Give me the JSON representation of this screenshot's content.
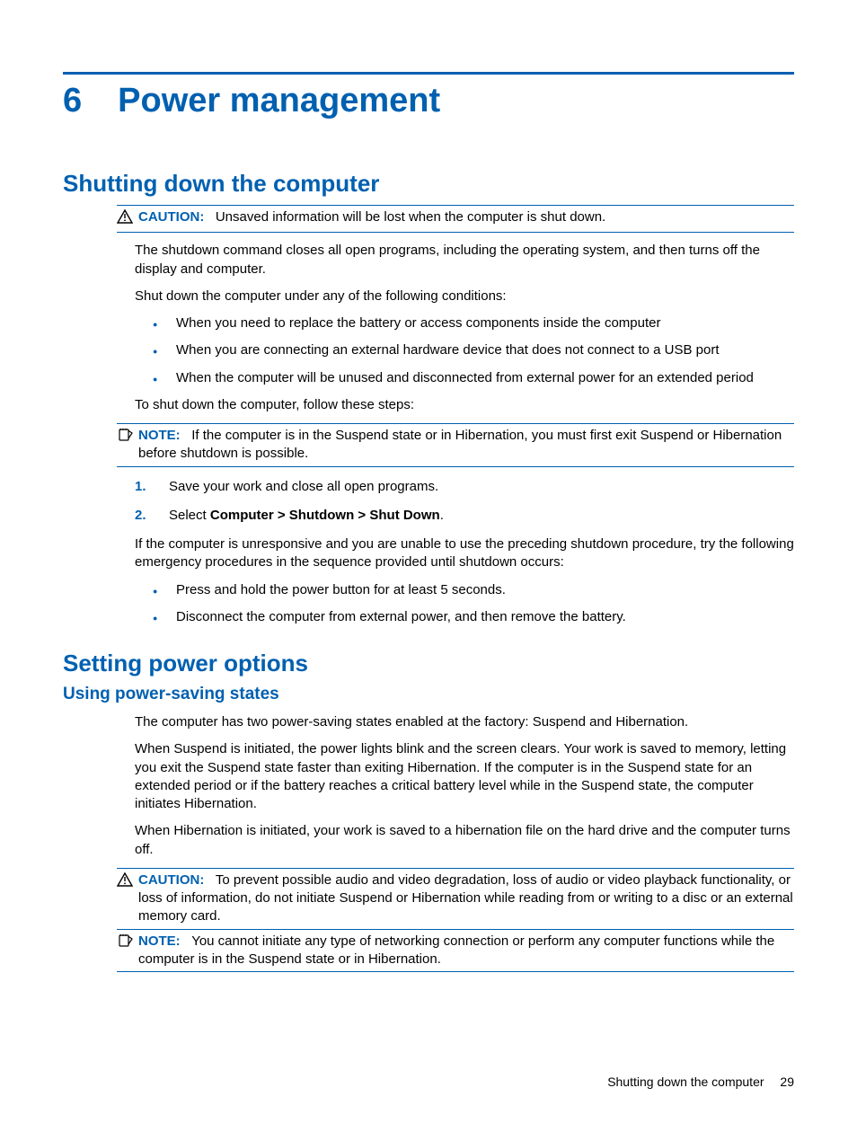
{
  "chapter": {
    "number": "6",
    "title": "Power management"
  },
  "h2a": "Shutting down the computer",
  "caution1": {
    "label": "CAUTION:",
    "text": "Unsaved information will be lost when the computer is shut down."
  },
  "p_shutdown_cmd": "The shutdown command closes all open programs, including the operating system, and then turns off the display and computer.",
  "p_conditions_intro": "Shut down the computer under any of the following conditions:",
  "conditions": [
    "When you need to replace the battery or access components inside the computer",
    "When you are connecting an external hardware device that does not connect to a USB port",
    "When the computer will be unused and disconnected from external power for an extended period"
  ],
  "p_steps_intro": "To shut down the computer, follow these steps:",
  "note1": {
    "label": "NOTE:",
    "text": "If the computer is in the Suspend state or in Hibernation, you must first exit Suspend or Hibernation before shutdown is possible."
  },
  "steps": {
    "s1": "Save your work and close all open programs.",
    "s2_prefix": "Select ",
    "s2_bold": "Computer > Shutdown > Shut Down",
    "s2_suffix": "."
  },
  "p_unresponsive": "If the computer is unresponsive and you are unable to use the preceding shutdown procedure, try the following emergency procedures in the sequence provided until shutdown occurs:",
  "emergency": [
    "Press and hold the power button for at least 5 seconds.",
    "Disconnect the computer from external power, and then remove the battery."
  ],
  "h2b": "Setting power options",
  "h3a": "Using power-saving states",
  "p_ps1": "The computer has two power-saving states enabled at the factory: Suspend and Hibernation.",
  "p_ps2": "When Suspend is initiated, the power lights blink and the screen clears. Your work is saved to memory, letting you exit the Suspend state faster than exiting Hibernation. If the computer is in the Suspend state for an extended period or if the battery reaches a critical battery level while in the Suspend state, the computer initiates Hibernation.",
  "p_ps3": "When Hibernation is initiated, your work is saved to a hibernation file on the hard drive and the computer turns off.",
  "caution2": {
    "label": "CAUTION:",
    "text": "To prevent possible audio and video degradation, loss of audio or video playback functionality, or loss of information, do not initiate Suspend or Hibernation while reading from or writing to a disc or an external memory card."
  },
  "note2": {
    "label": "NOTE:",
    "text": "You cannot initiate any type of networking connection or perform any computer functions while the computer is in the Suspend state or in Hibernation."
  },
  "footer": {
    "text": "Shutting down the computer",
    "page": "29"
  }
}
